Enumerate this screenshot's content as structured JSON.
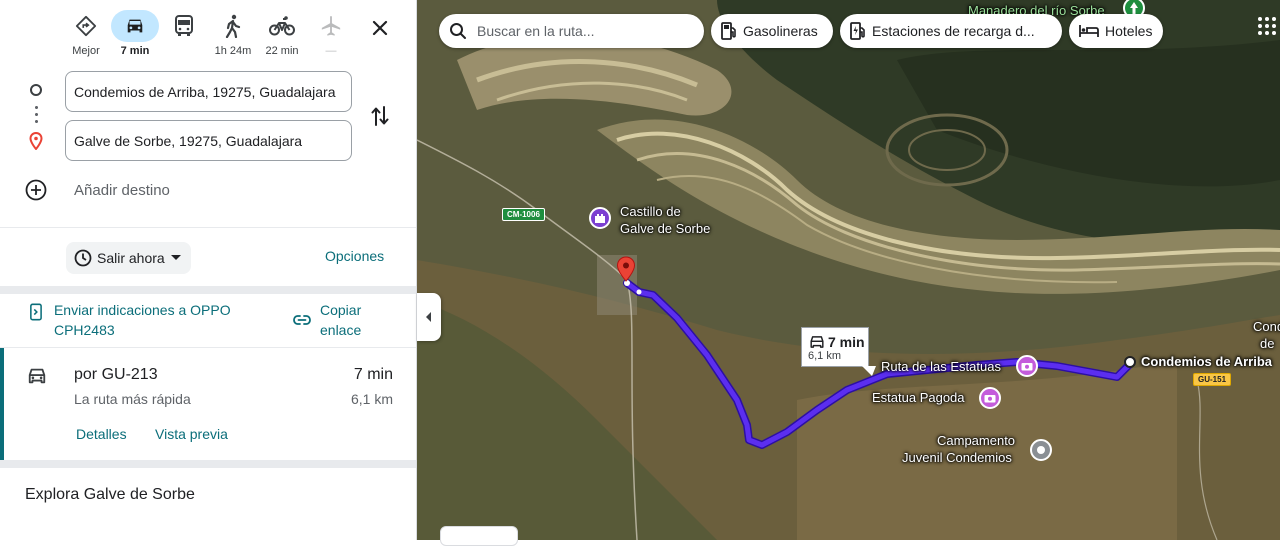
{
  "modes": [
    {
      "name": "best",
      "label": "Mejor",
      "active": false
    },
    {
      "name": "car",
      "label": "7 min",
      "active": true
    },
    {
      "name": "transit",
      "label": "",
      "active": false
    },
    {
      "name": "walk",
      "label": "1h 24m",
      "active": false
    },
    {
      "name": "bike",
      "label": "22 min",
      "active": false
    },
    {
      "name": "flight",
      "label": "—",
      "active": false
    }
  ],
  "origin": "Condemios de Arriba, 19275, Guadalajara",
  "destination": "Galve de Sorbe, 19275, Guadalajara",
  "add_destination": "Añadir destino",
  "depart": "Salir ahora",
  "options": "Opciones",
  "send_to_phone": "Enviar indicaciones a OPPO CPH2483",
  "copy_link": "Copiar enlace",
  "route": {
    "name": "por GU-213",
    "subtitle": "La ruta más rápida",
    "time": "7 min",
    "distance": "6,1 km",
    "details": "Detalles",
    "preview": "Vista previa"
  },
  "explore": "Explora Galve de Sorbe",
  "map": {
    "search_placeholder": "Buscar en la ruta...",
    "chips": [
      "Gasolineras",
      "Estaciones de recarga d...",
      "Hoteles"
    ],
    "labels": {
      "spring": "Manadero del río Sorbe",
      "castle_1": "Castillo de",
      "castle_2": "Galve de Sorbe",
      "statues_route": "Ruta de las Estatuas",
      "pagoda": "Estatua Pagoda",
      "camp_1": "Campamento",
      "camp_2": "Juvenil Condemios",
      "condemios": "Condemios de Arriba",
      "cond_partial_1": "Cond",
      "cond_partial_2": "de"
    },
    "road_shields": {
      "cm": "CM-1006",
      "gu": "GU-151"
    },
    "route_box": {
      "time": "7 min",
      "distance": "6,1 km"
    }
  },
  "colors": {
    "accent": "#0b6e7a",
    "route": "#4f1bdb",
    "active_mode": "#c2e7ff",
    "pin": "#ea4335"
  }
}
